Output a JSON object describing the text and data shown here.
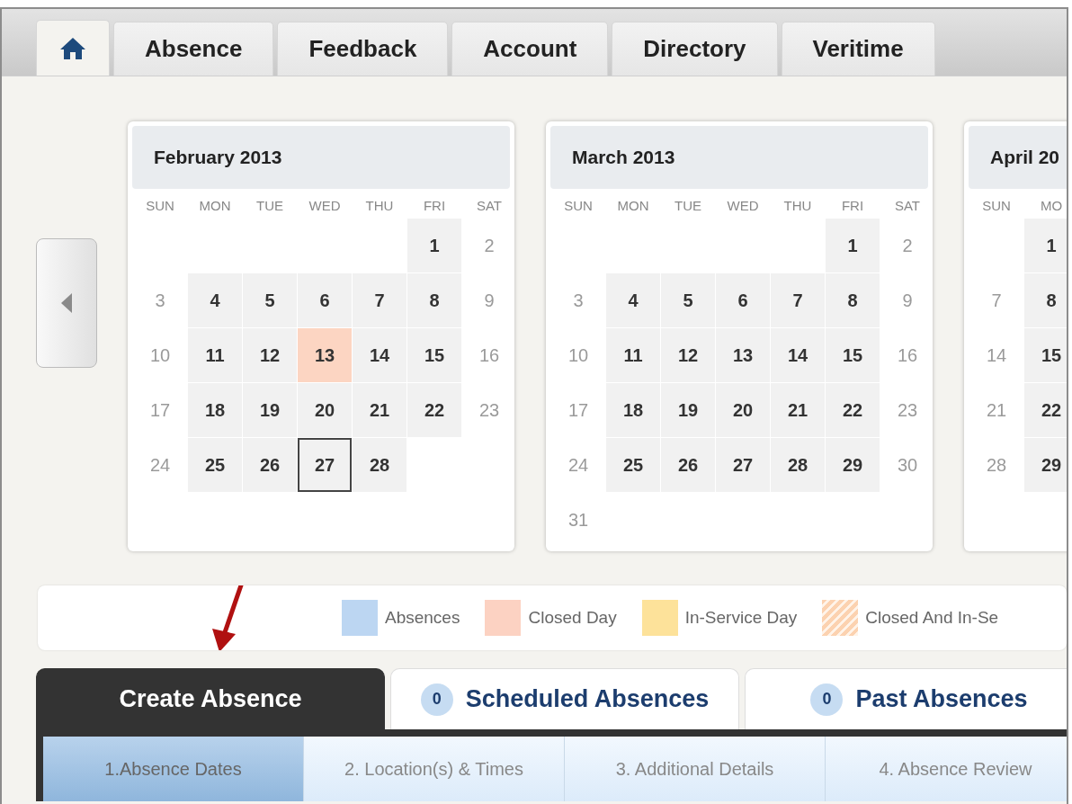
{
  "nav_tabs": [
    {
      "kind": "home",
      "selected": true
    },
    {
      "kind": "text",
      "label": "Absence",
      "selected": false
    },
    {
      "kind": "text",
      "label": "Feedback",
      "selected": false
    },
    {
      "kind": "text",
      "label": "Account",
      "selected": false
    },
    {
      "kind": "text",
      "label": "Directory",
      "selected": false
    },
    {
      "kind": "text",
      "label": "Veritime",
      "selected": false
    }
  ],
  "calendars": [
    {
      "title": "February 2013",
      "weekdays": [
        "SUN",
        "MON",
        "TUE",
        "WED",
        "THU",
        "FRI",
        "SAT"
      ],
      "weeks": [
        [
          {
            "kind": "blank"
          },
          {
            "kind": "blank"
          },
          {
            "kind": "blank"
          },
          {
            "kind": "blank"
          },
          {
            "kind": "blank"
          },
          {
            "kind": "weekday",
            "day": "1",
            "today": false
          },
          {
            "kind": "weekend",
            "day": "2",
            "today": false
          }
        ],
        [
          {
            "kind": "weekend",
            "day": "3",
            "today": false
          },
          {
            "kind": "weekday",
            "day": "4",
            "today": false
          },
          {
            "kind": "weekday",
            "day": "5",
            "today": false
          },
          {
            "kind": "weekday",
            "day": "6",
            "today": false
          },
          {
            "kind": "weekday",
            "day": "7",
            "today": false
          },
          {
            "kind": "weekday",
            "day": "8",
            "today": false
          },
          {
            "kind": "weekend",
            "day": "9",
            "today": false
          }
        ],
        [
          {
            "kind": "weekend",
            "day": "10",
            "today": false
          },
          {
            "kind": "weekday",
            "day": "11",
            "today": false
          },
          {
            "kind": "weekday",
            "day": "12",
            "today": false
          },
          {
            "kind": "closed",
            "day": "13",
            "today": false
          },
          {
            "kind": "weekday",
            "day": "14",
            "today": false
          },
          {
            "kind": "weekday",
            "day": "15",
            "today": false
          },
          {
            "kind": "weekend",
            "day": "16",
            "today": false
          }
        ],
        [
          {
            "kind": "weekend",
            "day": "17",
            "today": false
          },
          {
            "kind": "weekday",
            "day": "18",
            "today": false
          },
          {
            "kind": "weekday",
            "day": "19",
            "today": false
          },
          {
            "kind": "weekday",
            "day": "20",
            "today": false
          },
          {
            "kind": "weekday",
            "day": "21",
            "today": false
          },
          {
            "kind": "weekday",
            "day": "22",
            "today": false
          },
          {
            "kind": "weekend",
            "day": "23",
            "today": false
          }
        ],
        [
          {
            "kind": "weekend",
            "day": "24",
            "today": false
          },
          {
            "kind": "weekday",
            "day": "25",
            "today": false
          },
          {
            "kind": "weekday",
            "day": "26",
            "today": false
          },
          {
            "kind": "weekday",
            "day": "27",
            "today": true
          },
          {
            "kind": "weekday",
            "day": "28",
            "today": false
          }
        ]
      ]
    },
    {
      "title": "March 2013",
      "weekdays": [
        "SUN",
        "MON",
        "TUE",
        "WED",
        "THU",
        "FRI",
        "SAT"
      ],
      "weeks": [
        [
          {
            "kind": "blank"
          },
          {
            "kind": "blank"
          },
          {
            "kind": "blank"
          },
          {
            "kind": "blank"
          },
          {
            "kind": "blank"
          },
          {
            "kind": "weekday",
            "day": "1",
            "today": false
          },
          {
            "kind": "weekend",
            "day": "2",
            "today": false
          }
        ],
        [
          {
            "kind": "weekend",
            "day": "3",
            "today": false
          },
          {
            "kind": "weekday",
            "day": "4",
            "today": false
          },
          {
            "kind": "weekday",
            "day": "5",
            "today": false
          },
          {
            "kind": "weekday",
            "day": "6",
            "today": false
          },
          {
            "kind": "weekday",
            "day": "7",
            "today": false
          },
          {
            "kind": "weekday",
            "day": "8",
            "today": false
          },
          {
            "kind": "weekend",
            "day": "9",
            "today": false
          }
        ],
        [
          {
            "kind": "weekend",
            "day": "10",
            "today": false
          },
          {
            "kind": "weekday",
            "day": "11",
            "today": false
          },
          {
            "kind": "weekday",
            "day": "12",
            "today": false
          },
          {
            "kind": "weekday",
            "day": "13",
            "today": false
          },
          {
            "kind": "weekday",
            "day": "14",
            "today": false
          },
          {
            "kind": "weekday",
            "day": "15",
            "today": false
          },
          {
            "kind": "weekend",
            "day": "16",
            "today": false
          }
        ],
        [
          {
            "kind": "weekend",
            "day": "17",
            "today": false
          },
          {
            "kind": "weekday",
            "day": "18",
            "today": false
          },
          {
            "kind": "weekday",
            "day": "19",
            "today": false
          },
          {
            "kind": "weekday",
            "day": "20",
            "today": false
          },
          {
            "kind": "weekday",
            "day": "21",
            "today": false
          },
          {
            "kind": "weekday",
            "day": "22",
            "today": false
          },
          {
            "kind": "weekend",
            "day": "23",
            "today": false
          }
        ],
        [
          {
            "kind": "weekend",
            "day": "24",
            "today": false
          },
          {
            "kind": "weekday",
            "day": "25",
            "today": false
          },
          {
            "kind": "weekday",
            "day": "26",
            "today": false
          },
          {
            "kind": "weekday",
            "day": "27",
            "today": false
          },
          {
            "kind": "weekday",
            "day": "28",
            "today": false
          },
          {
            "kind": "weekday",
            "day": "29",
            "today": false
          },
          {
            "kind": "weekend",
            "day": "30",
            "today": false
          }
        ],
        [
          {
            "kind": "weekend",
            "day": "31",
            "today": false
          }
        ]
      ]
    },
    {
      "title": "April 20",
      "weekdays": [
        "SUN",
        "MO"
      ],
      "weeks": [
        [
          {
            "kind": "blank"
          },
          {
            "kind": "weekday",
            "day": "1",
            "today": false
          }
        ],
        [
          {
            "kind": "weekend",
            "day": "7",
            "today": false
          },
          {
            "kind": "weekday",
            "day": "8",
            "today": false
          }
        ],
        [
          {
            "kind": "weekend",
            "day": "14",
            "today": false
          },
          {
            "kind": "weekday",
            "day": "15",
            "today": false
          }
        ],
        [
          {
            "kind": "weekend",
            "day": "21",
            "today": false
          },
          {
            "kind": "weekday",
            "day": "22",
            "today": false
          }
        ],
        [
          {
            "kind": "weekend",
            "day": "28",
            "today": false
          },
          {
            "kind": "weekday",
            "day": "29",
            "today": false
          }
        ]
      ]
    }
  ],
  "legend": [
    {
      "label": "Absences",
      "color": "#bcd6f2",
      "kind": "solid"
    },
    {
      "label": "Closed Day",
      "color": "#fcd2c2",
      "kind": "solid"
    },
    {
      "label": "In-Service Day",
      "color": "#fde29a",
      "kind": "solid"
    },
    {
      "label": "Closed And In-Se",
      "color": "#fcd2b0",
      "kind": "striped"
    }
  ],
  "absence_tabs": [
    {
      "label": "Create Absence",
      "selected": true
    },
    {
      "label": "Scheduled Absences",
      "count": "0",
      "selected": false
    },
    {
      "label": "Past Absences",
      "count": "0",
      "selected": false
    }
  ],
  "steps": [
    {
      "label": "1.Absence Dates",
      "selected": true
    },
    {
      "label": "2. Location(s) & Times",
      "selected": false
    },
    {
      "label": "3. Additional Details",
      "selected": false
    },
    {
      "label": "4. Absence Review",
      "selected": false
    }
  ]
}
